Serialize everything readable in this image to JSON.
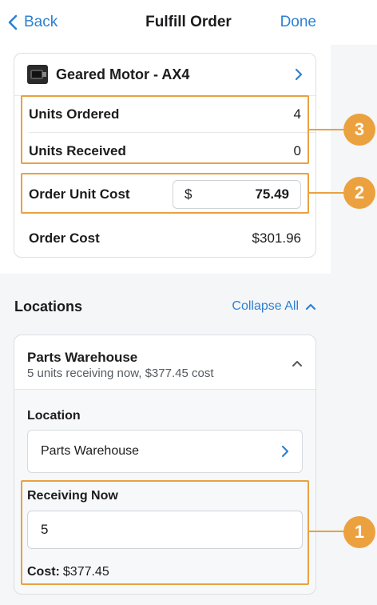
{
  "nav": {
    "back_label": "Back",
    "title": "Fulfill Order",
    "done_label": "Done"
  },
  "order": {
    "product_name": "Geared Motor - AX4",
    "units_ordered_label": "Units Ordered",
    "units_ordered_value": "4",
    "units_received_label": "Units Received",
    "units_received_value": "0",
    "unit_cost_label": "Order Unit Cost",
    "currency_symbol": "$",
    "unit_cost_value": "75.49",
    "order_cost_label": "Order Cost",
    "order_cost_value": "$301.96"
  },
  "locations": {
    "heading": "Locations",
    "collapse_label": "Collapse All",
    "card": {
      "name": "Parts Warehouse",
      "summary": "5 units receiving now, $377.45 cost",
      "location_label": "Location",
      "location_value": "Parts Warehouse",
      "receiving_label": "Receiving Now",
      "receiving_value": "5",
      "cost_label": "Cost:",
      "cost_value": "$377.45"
    }
  },
  "callouts": [
    "1",
    "2",
    "3"
  ],
  "colors": {
    "accent": "#2f80d1",
    "callout": "#eca13f"
  },
  "icons": [
    "chevron-left-icon",
    "chevron-right-icon",
    "chevron-up-icon",
    "product-thumbnail"
  ]
}
